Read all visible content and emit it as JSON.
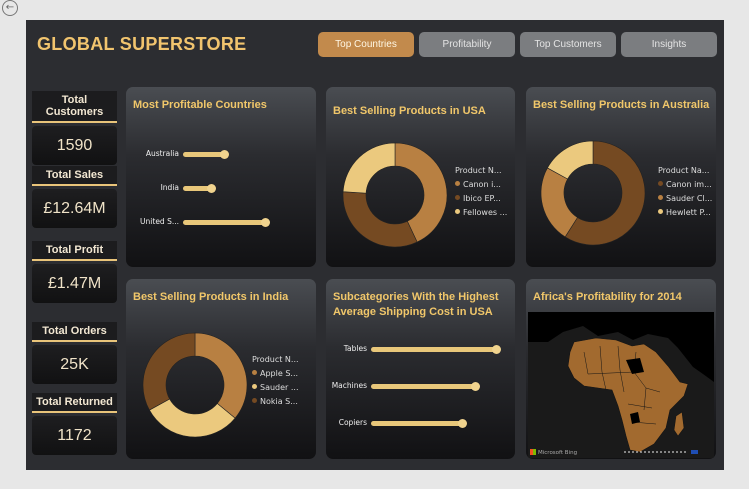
{
  "app": {
    "title": "GLOBAL SUPERSTORE",
    "back_icon": "back-arrow-icon"
  },
  "tabs": [
    {
      "label": "Top Countries",
      "active": true
    },
    {
      "label": "Profitability",
      "active": false
    },
    {
      "label": "Top Customers",
      "active": false
    },
    {
      "label": "Insights",
      "active": false
    }
  ],
  "kpis": {
    "customers": {
      "label": "Total Customers",
      "value": "1590"
    },
    "sales": {
      "label": "Total Sales",
      "value": "£12.64M"
    },
    "profit": {
      "label": "Total Profit",
      "value": "£1.47M"
    },
    "orders": {
      "label": "Total Orders",
      "value": "25K"
    },
    "returned": {
      "label": "Total Returned",
      "value": "1172"
    }
  },
  "cards": {
    "profitable_countries": {
      "title": "Most Profitable Countries"
    },
    "usa_products": {
      "title": "Best Selling Products in USA"
    },
    "australia_products": {
      "title": "Best Selling Products in Australia"
    },
    "india_products": {
      "title": "Best Selling Products in India"
    },
    "shipping_cost": {
      "title_line1": "Subcategories With the Highest",
      "title_line2": "Average Shipping Cost in USA"
    },
    "africa_map": {
      "title": "Africa's Profitability for 2014",
      "provider": "Microsoft Bing"
    }
  },
  "colors": {
    "accent": "#f1c46e",
    "slice_dark": "#754a22",
    "slice_mid": "#b88042",
    "slice_light": "#ebc97e",
    "bar": "#e8c77a",
    "africa_land": "#a26a2f"
  },
  "chart_data": [
    {
      "type": "bar",
      "orientation": "horizontal",
      "title": "Most Profitable Countries",
      "categories": [
        "Australia",
        "India",
        "United S..."
      ],
      "values": [
        0.42,
        0.29,
        0.85
      ]
    },
    {
      "type": "pie",
      "donut": true,
      "title": "Best Selling Products in USA",
      "legend_title": "Product N...",
      "labels": [
        "Canon i...",
        "Ibico EP...",
        "Fellowes ..."
      ],
      "values": [
        0.43,
        0.33,
        0.24
      ],
      "colors": [
        "#b88042",
        "#754a22",
        "#ebc97e"
      ],
      "start_angle": 90
    },
    {
      "type": "pie",
      "donut": true,
      "title": "Best Selling Products in Australia",
      "legend_title": "Product Na...",
      "labels": [
        "Canon im...",
        "Sauder Cl...",
        "Hewlett P..."
      ],
      "values": [
        0.59,
        0.24,
        0.17
      ],
      "colors": [
        "#754a22",
        "#b88042",
        "#ebc97e"
      ],
      "start_angle": 90
    },
    {
      "type": "pie",
      "donut": true,
      "title": "Best Selling Products in India",
      "legend_title": "Product N...",
      "labels": [
        "Apple S...",
        "Sauder ...",
        "Nokia S..."
      ],
      "values": [
        0.36,
        0.31,
        0.33
      ],
      "colors": [
        "#b88042",
        "#ebc97e",
        "#754a22"
      ],
      "start_angle": 90
    },
    {
      "type": "bar",
      "orientation": "horizontal",
      "title": "Subcategories With the Highest Average Shipping Cost in USA",
      "categories": [
        "Tables",
        "Machines",
        "Copiers"
      ],
      "values": [
        1.0,
        0.83,
        0.73
      ]
    }
  ]
}
